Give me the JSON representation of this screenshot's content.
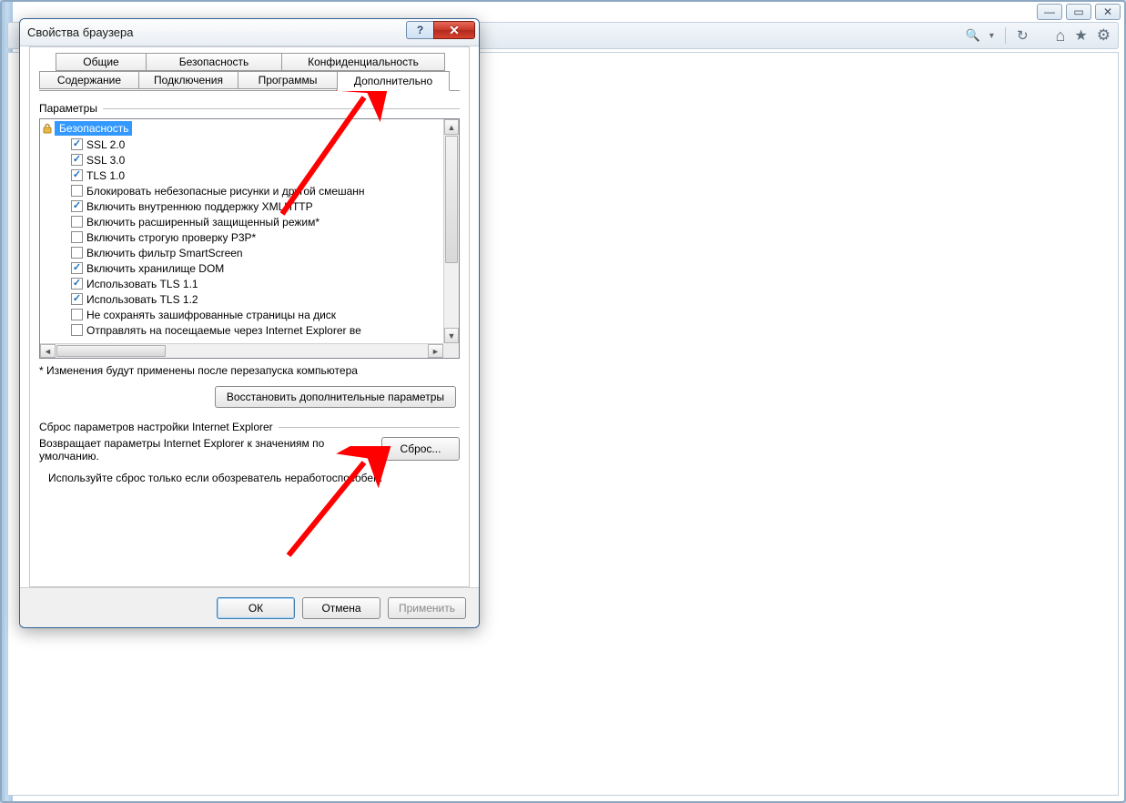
{
  "dialog": {
    "title": "Свойства браузера",
    "helpGlyph": "?",
    "closeGlyph": "✕",
    "tabs_row1": [
      "Общие",
      "Безопасность",
      "Конфиденциальность"
    ],
    "tabs_row2": [
      "Содержание",
      "Подключения",
      "Программы",
      "Дополнительно"
    ],
    "active_tab": "Дополнительно",
    "parameters_label": "Параметры",
    "security_category": "Безопасность",
    "items": [
      {
        "checked": true,
        "label": "SSL 2.0"
      },
      {
        "checked": true,
        "label": "SSL 3.0"
      },
      {
        "checked": true,
        "label": "TLS 1.0"
      },
      {
        "checked": false,
        "label": "Блокировать небезопасные рисунки и другой смешанн"
      },
      {
        "checked": true,
        "label": "Включить внутреннюю поддержку XMLHTTP"
      },
      {
        "checked": false,
        "label": "Включить расширенный защищенный режим*"
      },
      {
        "checked": false,
        "label": "Включить строгую проверку P3P*"
      },
      {
        "checked": false,
        "label": "Включить фильтр SmartScreen"
      },
      {
        "checked": true,
        "label": "Включить хранилище DOM"
      },
      {
        "checked": true,
        "label": "Использовать TLS 1.1"
      },
      {
        "checked": true,
        "label": "Использовать TLS 1.2"
      },
      {
        "checked": false,
        "label": "Не сохранять зашифрованные страницы на диск"
      },
      {
        "checked": false,
        "label": "Отправлять на посещаемые через Internet Explorer ве"
      }
    ],
    "restart_note": "* Изменения будут применены после перезапуска компьютера",
    "restore_button": "Восстановить дополнительные параметры",
    "reset_section_label": "Сброс параметров настройки Internet Explorer",
    "reset_text": "Возвращает параметры Internet Explorer к значениям по умолчанию.",
    "reset_button": "Сброс...",
    "reset_note": "Используйте сброс только если обозреватель неработоспособен.",
    "ok": "ОК",
    "cancel": "Отмена",
    "apply": "Применить"
  },
  "toolbar": {
    "search": "🔍",
    "refresh": "↻",
    "home": "⌂",
    "favorites": "★",
    "gear": "⚙"
  },
  "bg_window": {
    "min": "—",
    "max": "▭",
    "close": "✕"
  }
}
